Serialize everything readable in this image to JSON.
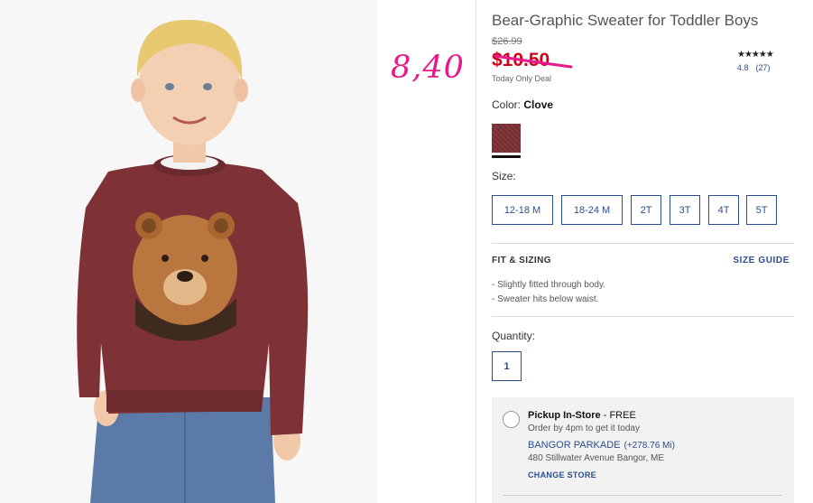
{
  "annotation": "8,40",
  "product": {
    "title": "Bear-Graphic Sweater for Toddler Boys",
    "original_price": "$26.99",
    "sale_price": "$10.50",
    "deal_label": "Today Only Deal",
    "stars": "★★★★★",
    "rating": "4.8",
    "review_count": "(27)"
  },
  "color": {
    "label": "Color:",
    "selected": "Clove",
    "swatch_hex": "#7b2f34"
  },
  "size": {
    "label": "Size:",
    "options": [
      "12-18 M",
      "18-24 M",
      "2T",
      "3T",
      "4T",
      "5T"
    ]
  },
  "fit": {
    "heading": "FIT & SIZING",
    "size_guide": "SIZE GUIDE",
    "notes": [
      "Slightly fitted through body.",
      "Sweater hits below waist."
    ]
  },
  "quantity": {
    "label": "Quantity:",
    "value": "1"
  },
  "pickup": {
    "title": "Pickup In-Store",
    "suffix": " - FREE",
    "subtitle": "Order by 4pm to get it today",
    "store_name": "BANGOR PARKADE",
    "distance": "(+278.76 Mi)",
    "address": "480 Stillwater Avenue Bangor, ME",
    "change_label": "CHANGE STORE"
  },
  "colors": {
    "accent": "#2a4d8f",
    "sale": "#d0021b",
    "annotation": "#e8198b"
  }
}
